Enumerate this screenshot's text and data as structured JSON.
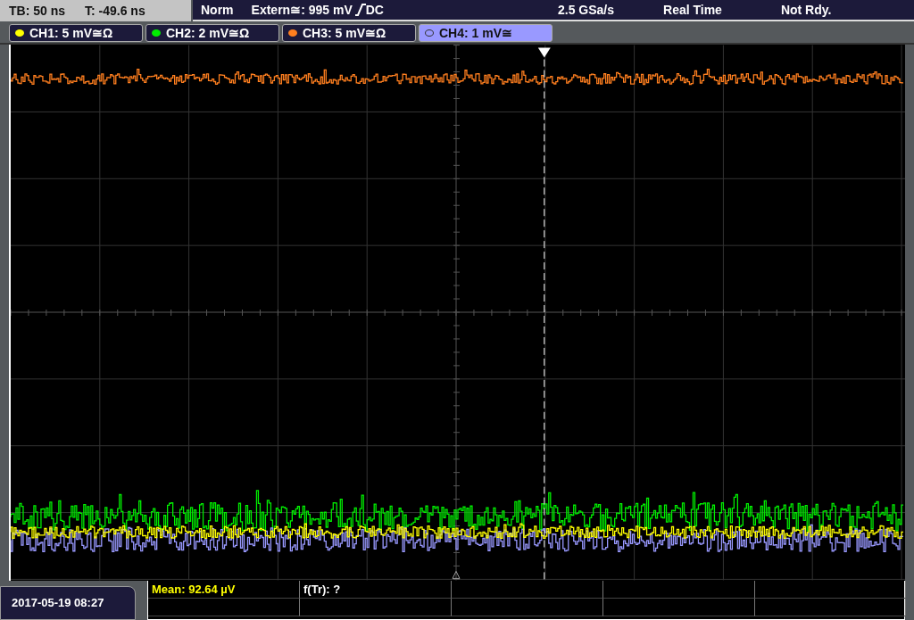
{
  "status_left": {
    "timebase": "TB: 50 ns",
    "trigger_time": "T: -49.6 ns"
  },
  "status_bar": {
    "mode": "Norm",
    "trigger": "Extern≅: 995 mV",
    "coupling": "DC",
    "sample_rate": "2.5 GSa/s",
    "acquisition": "Real Time",
    "state": "Not Rdy."
  },
  "channels": [
    {
      "label": "CH1: 5 mV≅Ω",
      "color": "#ffff00",
      "selected": false
    },
    {
      "label": "CH2: 2 mV≅Ω",
      "color": "#00ee00",
      "selected": false
    },
    {
      "label": "CH3: 5 mV≅Ω",
      "color": "#ff7f1f",
      "selected": false
    },
    {
      "label": "CH4: 1 mV≅",
      "color": "#9999ff",
      "selected": true
    }
  ],
  "date": "2017-05-19 08:27",
  "measurements": [
    {
      "text": "Mean: 92.64 µV",
      "color": "#ffff00"
    },
    {
      "text": "f(Tr): ?",
      "color": "#ffffff"
    }
  ]
}
